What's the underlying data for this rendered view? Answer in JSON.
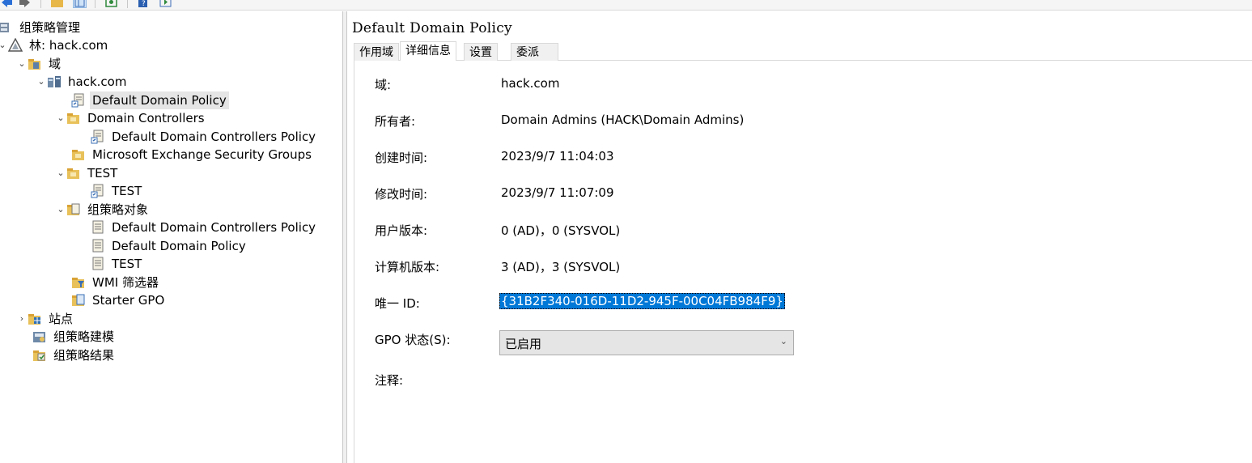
{
  "toolbar": {
    "buttons": [
      "back-icon",
      "forward-icon",
      "folder-icon",
      "show-hide-tree-icon",
      "refresh-icon",
      "help-icon",
      "action-pane-icon"
    ]
  },
  "tree": {
    "root": "组策略管理",
    "forest": "林: hack.com",
    "domains": "域",
    "domain": "hack.com",
    "default_domain_policy": "Default Domain Policy",
    "domain_controllers": "Domain Controllers",
    "default_dc_policy_link": "Default Domain Controllers Policy",
    "ms_exchange": "Microsoft Exchange Security Groups",
    "test_ou": "TEST",
    "test_link": "TEST",
    "gpo_objects": "组策略对象",
    "gpo_dc_policy": "Default Domain Controllers Policy",
    "gpo_domain_policy": "Default Domain Policy",
    "gpo_test": "TEST",
    "wmi_filters": "WMI 筛选器",
    "starter_gpo": "Starter GPO",
    "sites": "站点",
    "modeling": "组策略建模",
    "results": "组策略结果"
  },
  "details": {
    "title": "Default Domain Policy",
    "tabs": [
      "作用域",
      "详细信息",
      "设置",
      "委派"
    ],
    "active_tab": "详细信息",
    "fields": {
      "domain_label": "域:",
      "domain_value": "hack.com",
      "owner_label": "所有者:",
      "owner_value": "Domain Admins (HACK\\Domain Admins)",
      "created_label": "创建时间:",
      "created_value": "2023/9/7 11:04:03",
      "modified_label": "修改时间:",
      "modified_value": "2023/9/7 11:07:09",
      "user_ver_label": "用户版本:",
      "user_ver_value": "0 (AD)，0 (SYSVOL)",
      "comp_ver_label": "计算机版本:",
      "comp_ver_value": "3 (AD)，3 (SYSVOL)",
      "uid_label": "唯一 ID:",
      "uid_value": "{31B2F340-016D-11D2-945F-00C04FB984F9}",
      "gpo_status_label": "GPO 状态(S):",
      "gpo_status_value": "已启用",
      "comment_label": "注释:"
    }
  }
}
